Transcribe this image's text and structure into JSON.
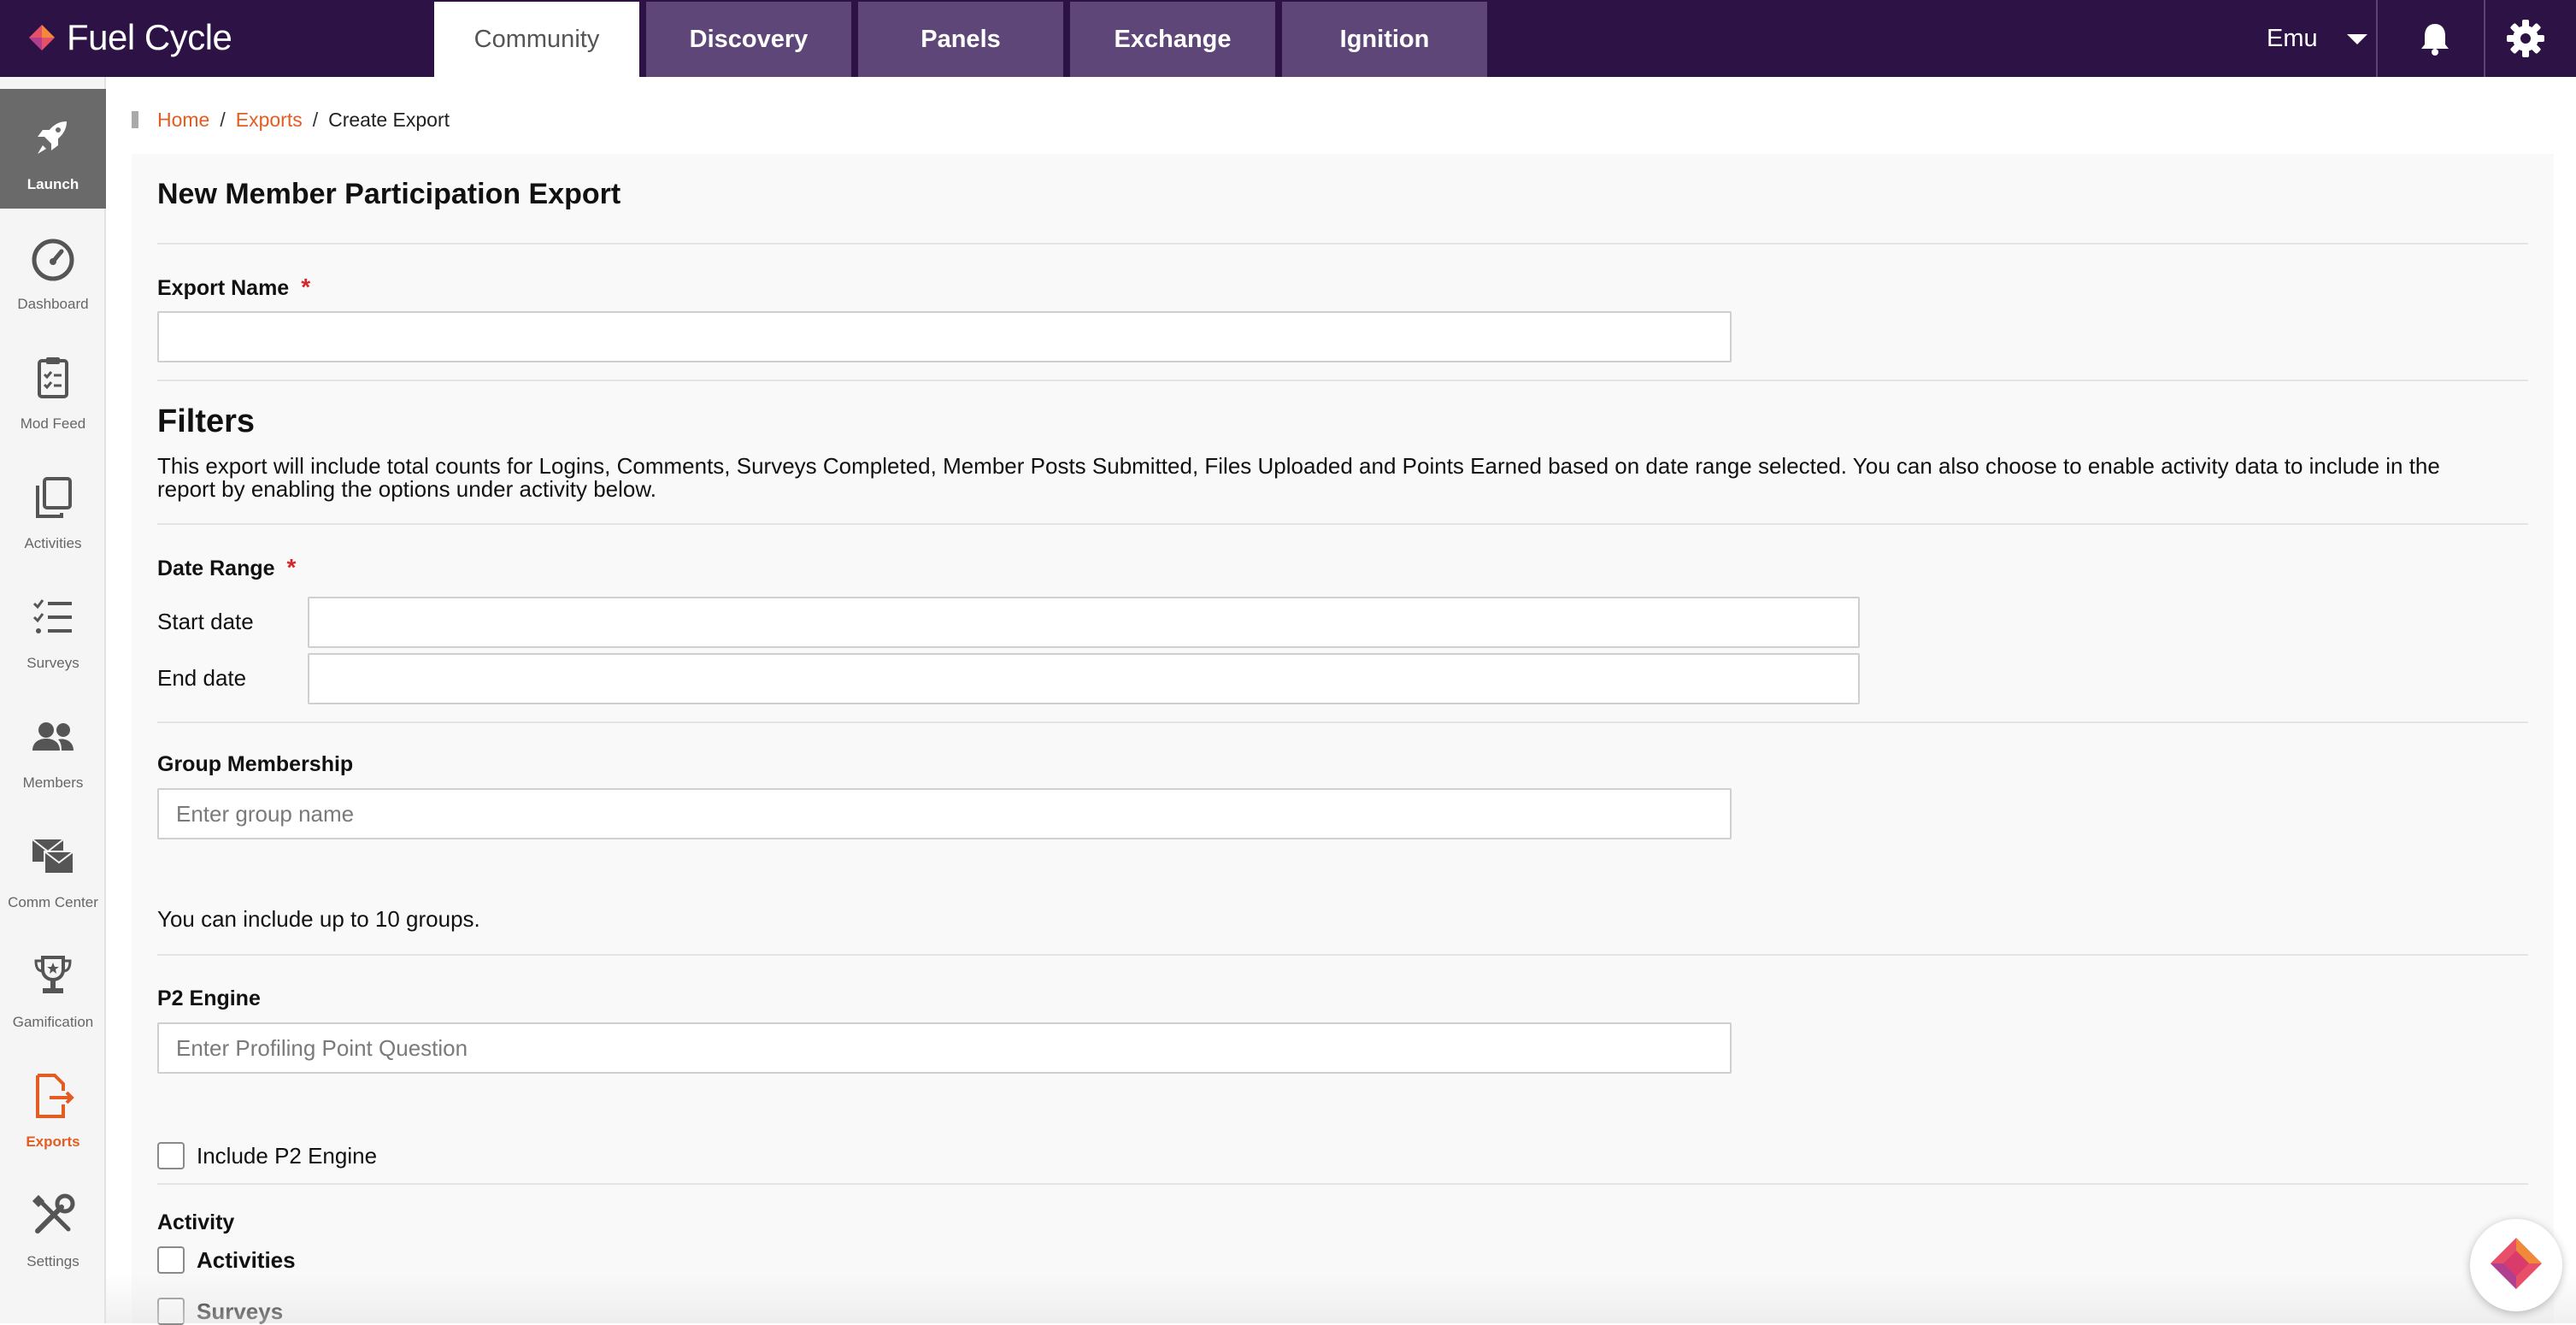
{
  "app": {
    "brand": "Fuel Cycle"
  },
  "colors": {
    "topbar": "#2d1245",
    "tab_inactive": "#5e4778",
    "accent": "#e35d22",
    "required": "#d4272c"
  },
  "nav": {
    "tabs": [
      {
        "label": "Community",
        "active": true
      },
      {
        "label": "Discovery",
        "active": false
      },
      {
        "label": "Panels",
        "active": false
      },
      {
        "label": "Exchange",
        "active": false
      },
      {
        "label": "Ignition",
        "active": false
      }
    ],
    "user": "Emu",
    "icons": [
      "bell-icon",
      "gear-icon"
    ]
  },
  "sidebar": {
    "items": [
      {
        "label": "Launch",
        "icon": "rocket-icon",
        "active": true
      },
      {
        "label": "Dashboard",
        "icon": "gauge-icon"
      },
      {
        "label": "Mod Feed",
        "icon": "clipboard-icon"
      },
      {
        "label": "Activities",
        "icon": "copy-icon"
      },
      {
        "label": "Surveys",
        "icon": "checklist-icon"
      },
      {
        "label": "Members",
        "icon": "users-icon"
      },
      {
        "label": "Comm Center",
        "icon": "envelopes-icon"
      },
      {
        "label": "Gamification",
        "icon": "trophy-icon"
      },
      {
        "label": "Exports",
        "icon": "export-file-icon",
        "highlight": true
      },
      {
        "label": "Settings",
        "icon": "tools-icon"
      }
    ]
  },
  "breadcrumb": {
    "home": "Home",
    "exports": "Exports",
    "current": "Create Export",
    "sep": "/"
  },
  "form": {
    "title": "New Member Participation Export",
    "export_name": {
      "label": "Export Name",
      "required": "*",
      "value": ""
    },
    "filters": {
      "heading": "Filters",
      "description": "This export will include total counts for Logins, Comments, Surveys Completed, Member Posts Submitted, Files Uploaded and Points Earned based on date range selected. You can also choose to enable activity data to include in the report by enabling the options under activity below."
    },
    "date_range": {
      "label": "Date Range",
      "required": "*",
      "start_label": "Start date",
      "end_label": "End date",
      "start_value": "",
      "end_value": ""
    },
    "group_membership": {
      "label": "Group Membership",
      "placeholder": "Enter group name",
      "hint": "You can include up to 10 groups."
    },
    "p2_engine": {
      "label": "P2 Engine",
      "placeholder": "Enter Profiling Point Question",
      "include_label": "Include P2 Engine",
      "include_checked": false
    },
    "activity": {
      "label": "Activity",
      "options": [
        {
          "label": "Activities",
          "checked": false
        },
        {
          "label": "Surveys",
          "checked": false
        }
      ]
    }
  }
}
